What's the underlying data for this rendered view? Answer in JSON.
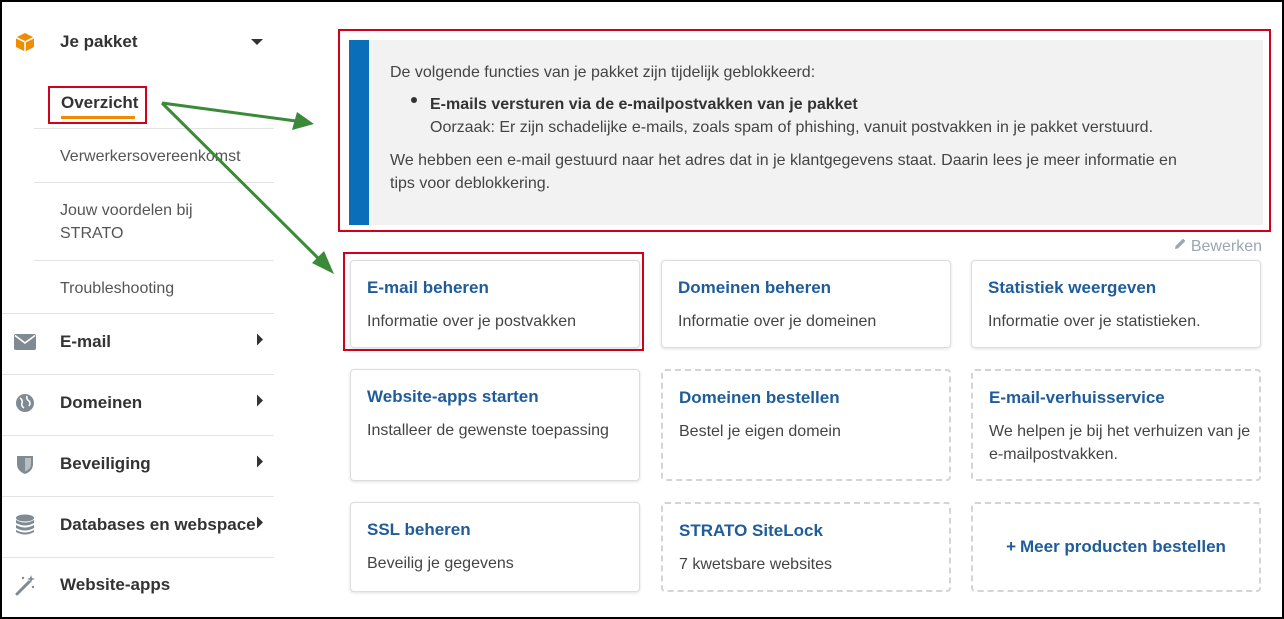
{
  "sidebar": {
    "package": {
      "label": "Je pakket",
      "icon": "box-icon"
    },
    "sub_items": {
      "overview": "Overzicht",
      "processing": "Verwerkersovereenkomst",
      "benefits_line1": "Jouw voordelen bij",
      "benefits_line2": "STRATO",
      "troubleshooting": "Troubleshooting"
    },
    "email": {
      "label": "E-mail",
      "icon": "envelope-icon"
    },
    "domains": {
      "label": "Domeinen",
      "icon": "globe-icon"
    },
    "security": {
      "label": "Beveiliging",
      "icon": "shield-icon"
    },
    "databases": {
      "label": "Databases en webspace",
      "icon": "database-icon"
    },
    "apps": {
      "label": "Website-apps",
      "icon": "magic-wand-icon"
    }
  },
  "notice": {
    "intro": "De volgende functies van je pakket zijn tijdelijk geblokkeerd:",
    "bullet_title": "E-mails versturen via de e-mailpostvakken van je pakket",
    "bullet_reason": "Oorzaak: Er zijn schadelijke e-mails, zoals spam of phishing, vanuit postvakken in je pakket verstuurd.",
    "body_line1": "We hebben een e-mail gestuurd naar het adres dat in je klantgegevens staat. Daarin lees je meer informatie en",
    "body_line2": "tips voor deblokkering."
  },
  "edit_label": "Bewerken",
  "cards": {
    "email_manage": {
      "title": "E-mail beheren",
      "desc": "Informatie over je postvakken"
    },
    "domains_manage": {
      "title": "Domeinen beheren",
      "desc": "Informatie over je domeinen"
    },
    "stats": {
      "title": "Statistiek weergeven",
      "desc": "Informatie over je statistieken."
    },
    "apps_start": {
      "title": "Website-apps starten",
      "desc": "Installeer de gewenste toepassing"
    },
    "domains_order": {
      "title": "Domeinen bestellen",
      "desc": "Bestel je eigen domein"
    },
    "moving": {
      "title": "E-mail-verhuisservice",
      "desc": "We helpen je bij het verhuizen van je e-mailpostvakken."
    },
    "ssl": {
      "title": "SSL beheren",
      "desc": "Beveilig je gegevens"
    },
    "sitelock": {
      "title": "STRATO SiteLock",
      "desc": "7 kwetsbare websites"
    },
    "more": {
      "plus": "+",
      "title": "Meer producten bestellen"
    }
  },
  "colors": {
    "accent_blue": "#0a6eb8",
    "link_blue": "#1f5c99",
    "highlight_red": "#d0021b",
    "annotation_green": "#3a8a3a",
    "brand_orange": "#f08c00"
  }
}
